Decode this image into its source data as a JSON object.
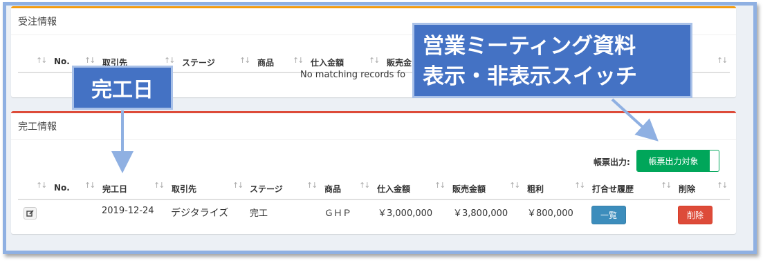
{
  "order_section": {
    "title": "受注情報",
    "columns": [
      "No.",
      "取引先",
      "ステージ",
      "商品",
      "仕入金額",
      "販売金"
    ],
    "empty_message": "No matching records fo"
  },
  "completion_section": {
    "title": "完工情報",
    "output_label": "帳票出力:",
    "output_toggle_label": "帳票出力対象",
    "columns": [
      "No.",
      "完工日",
      "取引先",
      "ステージ",
      "商品",
      "仕入金額",
      "販売金額",
      "粗利",
      "打合せ履歴",
      "削除"
    ],
    "rows": [
      {
        "no": "",
        "completion_date": "2019-12-24",
        "client": "デジタライズ",
        "stage": "完工",
        "product": "ＧＨＰ",
        "purchase_amount": "￥3,000,000",
        "sales_amount": "￥3,800,000",
        "gross_profit": "￥800,000",
        "history_button": "一覧",
        "delete_button": "削除"
      }
    ]
  },
  "annotations": {
    "completion_date_callout": "完工日",
    "switch_callout_line1": "営業ミーティング資料",
    "switch_callout_line2": "表示・非表示スイッチ"
  },
  "icons": {
    "sort": "sort-icon",
    "edit": "edit-icon"
  },
  "colors": {
    "orders_border": "#f39c12",
    "completion_border": "#dd4b39",
    "toggle_green": "#00a65a",
    "button_blue": "#3c8dbc",
    "button_red": "#dd4b39",
    "callout_blue": "#4472c4",
    "frame_blue": "#8fb0e2"
  }
}
